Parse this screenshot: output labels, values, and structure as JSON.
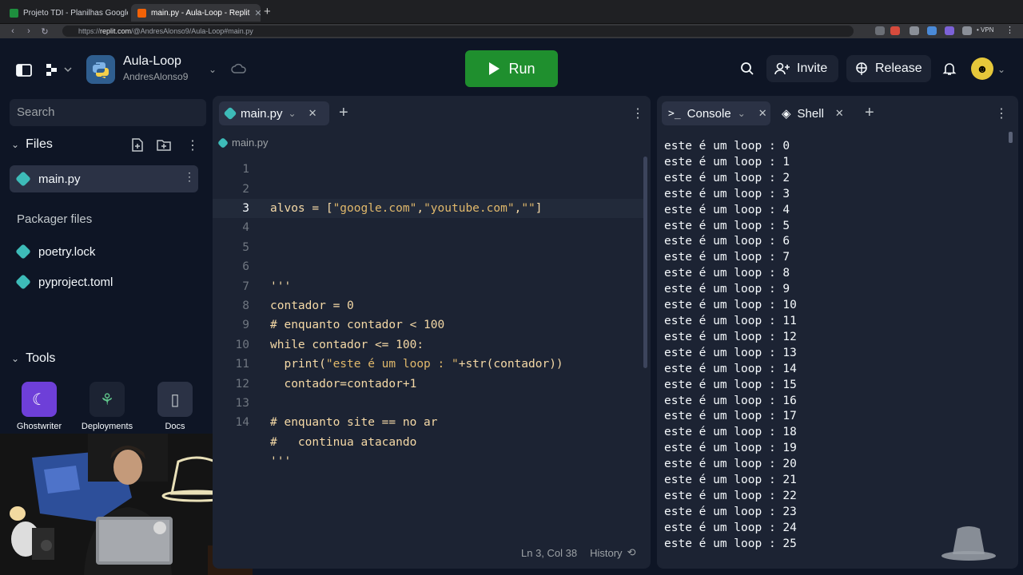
{
  "browser": {
    "tabs": [
      {
        "title": "Projeto TDI - Planilhas Google",
        "active": false
      },
      {
        "title": "main.py - Aula-Loop - Replit",
        "active": true
      }
    ],
    "url_prefix": "https://",
    "url_host": "replit.com",
    "url_path": "/@AndresAlonso9/Aula-Loop#main.py",
    "vpn_label": "• VPN"
  },
  "header": {
    "project_name": "Aula-Loop",
    "username": "AndresAlonso9",
    "run_label": "Run",
    "invite_label": "Invite",
    "release_label": "Release"
  },
  "sidebar": {
    "search_placeholder": "Search",
    "files_title": "Files",
    "files": [
      "main.py"
    ],
    "packager_title": "Packager files",
    "packager_files": [
      "poetry.lock",
      "pyproject.toml"
    ],
    "tools_title": "Tools",
    "tools": [
      "Ghostwriter",
      "Deployments",
      "Docs"
    ]
  },
  "editor": {
    "tab_label": "main.py",
    "breadcrumb": "main.py",
    "lines": [
      {
        "n": "1",
        "text": ""
      },
      {
        "n": "2",
        "text": ""
      },
      {
        "n": "3",
        "text": "alvos = [\"google.com\",\"youtube.com\",\"\"]"
      },
      {
        "n": "4",
        "text": ""
      },
      {
        "n": "5",
        "text": ""
      },
      {
        "n": "6",
        "text": ""
      },
      {
        "n": "7",
        "text": "'''"
      },
      {
        "n": "8",
        "text": "contador = 0"
      },
      {
        "n": "9",
        "text": "# enquanto contador < 100"
      },
      {
        "n": "10",
        "text": "while contador <= 100:"
      },
      {
        "n": "11",
        "text": "  print(\"este é um loop : \"+str(contador))"
      },
      {
        "n": "12",
        "text": "  contador=contador+1"
      },
      {
        "n": "13",
        "text": ""
      },
      {
        "n": "14",
        "text": "# enquanto site == no ar"
      },
      {
        "n": "",
        "text": "#   continua atacando"
      },
      {
        "n": "",
        "text": "'''"
      }
    ],
    "status_position": "Ln 3, Col 38",
    "history_label": "History"
  },
  "console": {
    "console_tab": "Console",
    "shell_tab": "Shell",
    "output": "este é um loop : 0\neste é um loop : 1\neste é um loop : 2\neste é um loop : 3\neste é um loop : 4\neste é um loop : 5\neste é um loop : 6\neste é um loop : 7\neste é um loop : 8\neste é um loop : 9\neste é um loop : 10\neste é um loop : 11\neste é um loop : 12\neste é um loop : 13\neste é um loop : 14\neste é um loop : 15\neste é um loop : 16\neste é um loop : 17\neste é um loop : 18\neste é um loop : 19\neste é um loop : 20\neste é um loop : 21\neste é um loop : 22\neste é um loop : 23\neste é um loop : 24\neste é um loop : 25"
  },
  "colors": {
    "accent_run": "#1f8f2e",
    "background": "#0e1525",
    "panel": "#1c2333",
    "string": "#e0b86b"
  }
}
